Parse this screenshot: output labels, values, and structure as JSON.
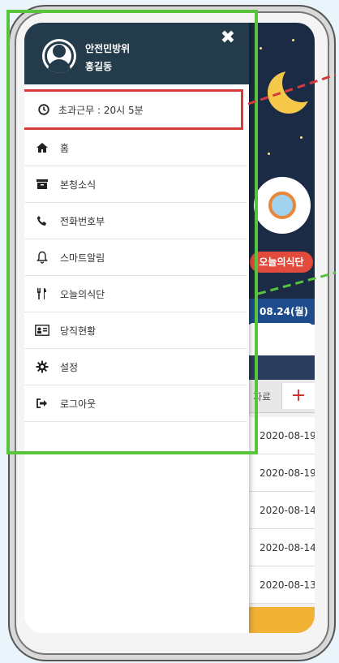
{
  "drawer": {
    "department": "안전민방위",
    "username": "홍길동",
    "close_label": "✖",
    "overtime": {
      "label": "초과근무 : 20시 5분",
      "icon": "clock-icon"
    },
    "items": [
      {
        "label": "홈",
        "icon": "home-icon"
      },
      {
        "label": "본청소식",
        "icon": "archive-icon"
      },
      {
        "label": "전화번호부",
        "icon": "phone-icon"
      },
      {
        "label": "스마트알림",
        "icon": "bell-icon"
      },
      {
        "label": "오늘의식단",
        "icon": "utensils-icon"
      },
      {
        "label": "당직현황",
        "icon": "id-card-icon"
      },
      {
        "label": "설정",
        "icon": "gear-icon"
      },
      {
        "label": "로그아웃",
        "icon": "sign-out-icon"
      }
    ]
  },
  "background": {
    "meal_chip": "오늘의식단",
    "date_band": "08.24(월)",
    "list_header": "자료",
    "add_label": "+",
    "dates": [
      "2020-08-19",
      "2020-08-19",
      "2020-08-14",
      "2020-08-14",
      "2020-08-13"
    ]
  },
  "colors": {
    "drawer_header": "#233b4b",
    "highlight_red": "#d63b3b",
    "highlight_green": "#58c43c",
    "night_sky": "#1b2a45"
  }
}
